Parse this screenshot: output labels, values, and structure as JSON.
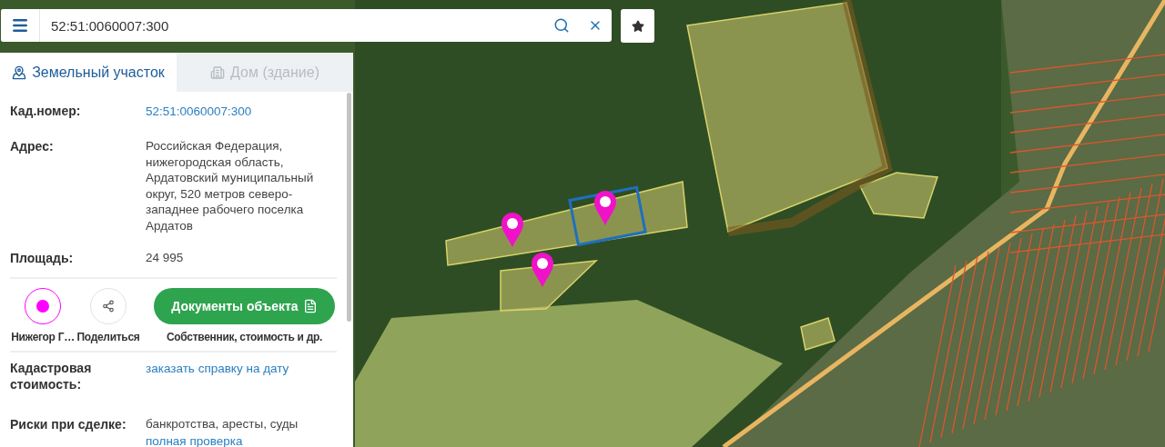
{
  "search": {
    "value": "52:51:0060007:300"
  },
  "tabs": [
    {
      "label": "Земельный участок",
      "selected": true,
      "kind": "parcel"
    },
    {
      "label": "Дом (здание)",
      "selected": false,
      "kind": "building"
    }
  ],
  "fields_top": [
    {
      "label": "Кад.номер:",
      "kind": "link",
      "value": "52:51:0060007:300"
    },
    {
      "label": "Адрес:",
      "kind": "text",
      "value": "Российская Федерация, нижегородская область, Ардатовский муниципальный округ, 520 метров северо-западнее рабочего поселка Ардатов"
    },
    {
      "label": "Площадь:",
      "kind": "text",
      "value": "24 995"
    }
  ],
  "actions": {
    "layer": {
      "label": "Нижегор Г…",
      "color": "#ff00ff"
    },
    "share": {
      "label": "Поделиться"
    },
    "documents": {
      "label": "Документы объекта",
      "caption": "Собственник, стоимость и др."
    }
  },
  "fields_bottom": [
    {
      "label": "Кадастровая стоимость:",
      "kind": "link",
      "value": "заказать справку на дату"
    },
    {
      "label": "Риски при сделке:",
      "kind": "text_link",
      "value": "банкротства, аресты, суды",
      "link": "полная проверка"
    }
  ]
}
